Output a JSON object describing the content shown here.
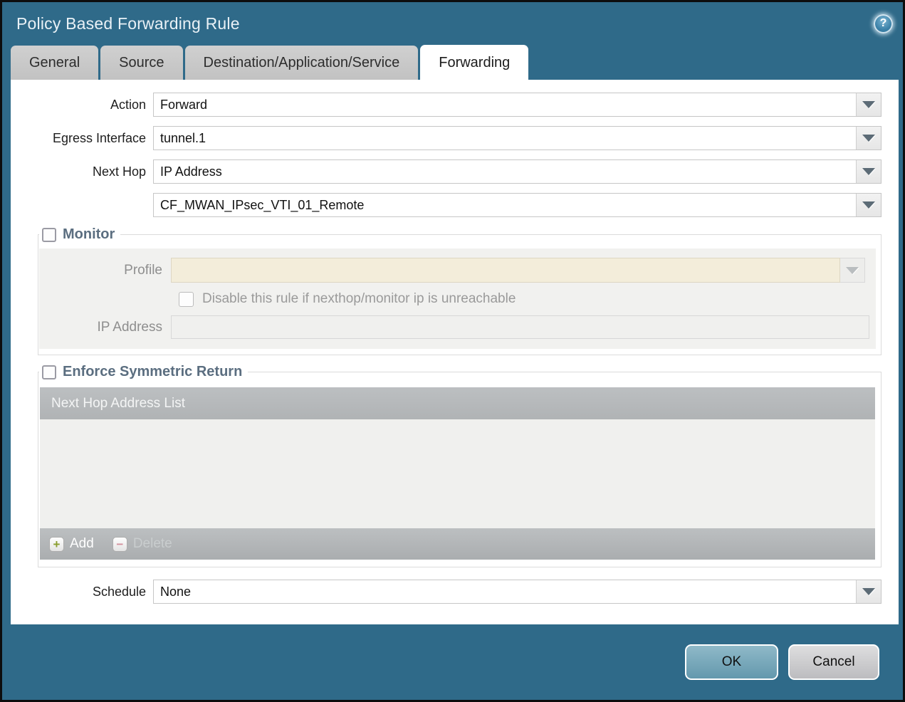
{
  "dialog": {
    "title": "Policy Based Forwarding Rule"
  },
  "help": {
    "glyph": "?"
  },
  "tabs": [
    {
      "label": "General",
      "active": false
    },
    {
      "label": "Source",
      "active": false
    },
    {
      "label": "Destination/Application/Service",
      "active": false
    },
    {
      "label": "Forwarding",
      "active": true
    }
  ],
  "form": {
    "action": {
      "label": "Action",
      "value": "Forward"
    },
    "egress_interface": {
      "label": "Egress Interface",
      "value": "tunnel.1"
    },
    "next_hop": {
      "label": "Next Hop",
      "value": "IP Address"
    },
    "next_hop_address": {
      "value": "CF_MWAN_IPsec_VTI_01_Remote"
    },
    "schedule": {
      "label": "Schedule",
      "value": "None"
    }
  },
  "monitor": {
    "legend": "Monitor",
    "checked": false,
    "profile": {
      "label": "Profile",
      "value": ""
    },
    "disable_rule": {
      "label": "Disable this rule if nexthop/monitor ip is unreachable",
      "checked": false
    },
    "ip_address": {
      "label": "IP Address",
      "value": ""
    }
  },
  "symmetric_return": {
    "legend": "Enforce Symmetric Return",
    "checked": false,
    "table_header": "Next Hop Address List",
    "rows": [],
    "add_label": "Add",
    "delete_label": "Delete",
    "add_icon_glyph": "+",
    "delete_icon_glyph": "−"
  },
  "footer": {
    "ok_label": "OK",
    "cancel_label": "Cancel"
  },
  "colors": {
    "titlebar": "#2f6a89",
    "ok_button": "#6fa3b8",
    "cancel_button": "#c9c9cb",
    "table_header_gray": "#b5b8ba",
    "disabled_field_cream": "#f3edda",
    "add_plus_green": "#8a9e2f",
    "delete_minus_pink": "#d3919d",
    "legend_text": "#5b6e80"
  }
}
